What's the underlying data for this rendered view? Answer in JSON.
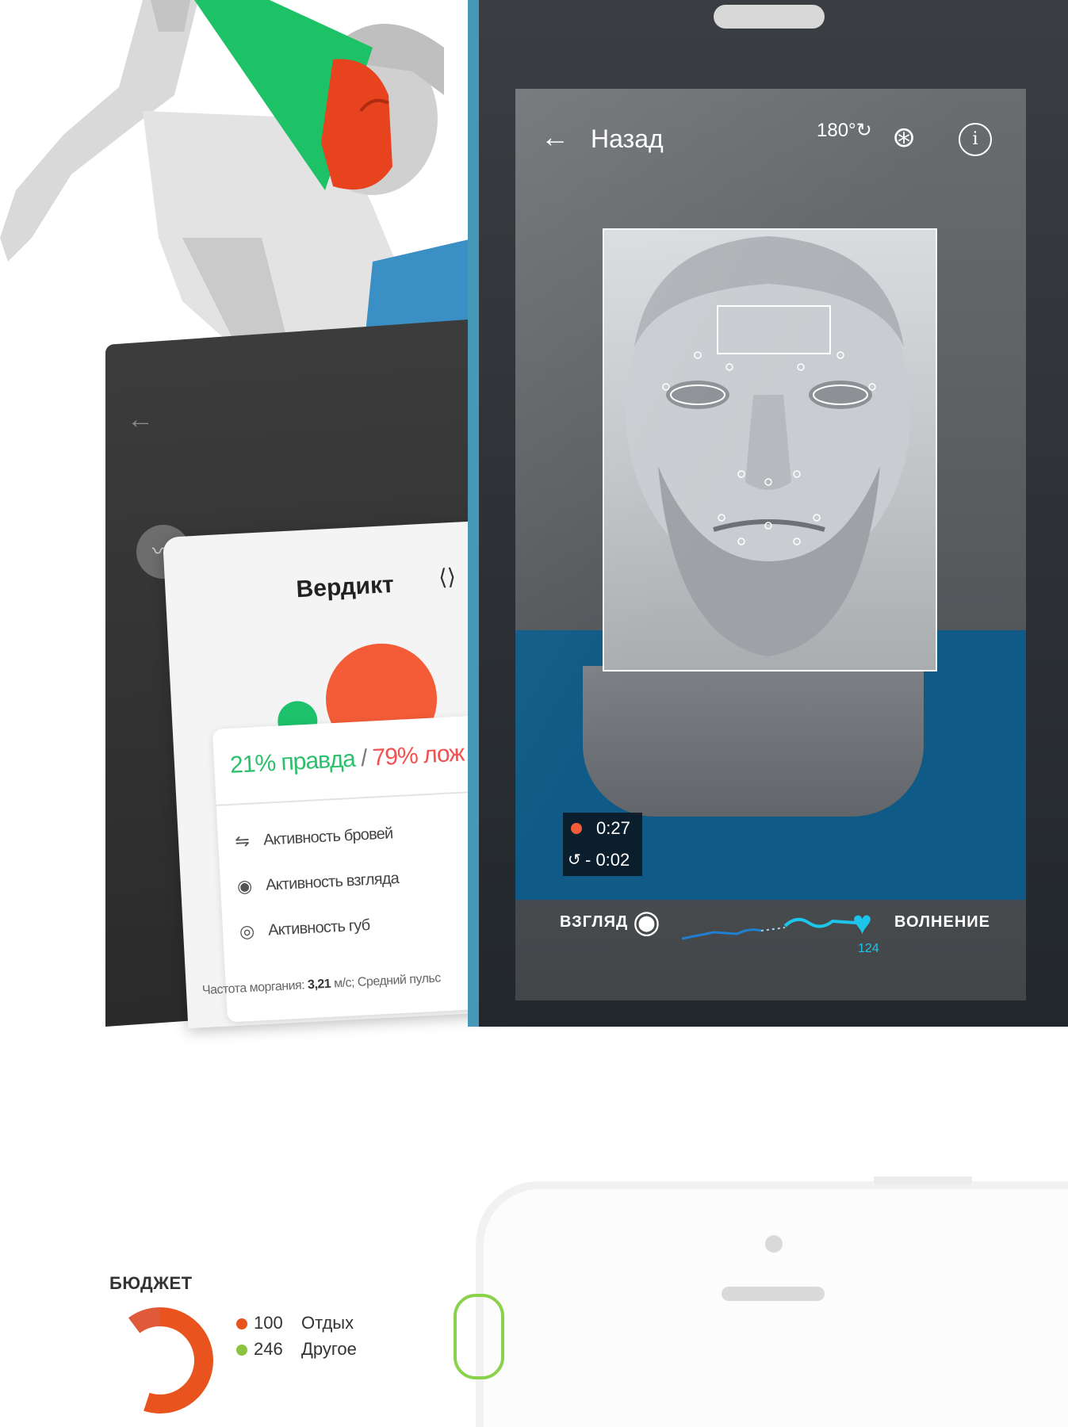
{
  "back_screen": {
    "back_arrow": "←",
    "avatar_icon": "lips-icon"
  },
  "verdict": {
    "title": "Вердикт",
    "share_icon": "share-icon",
    "result_true": "21% правда",
    "result_separator": " / ",
    "result_false": "79% лож",
    "metrics": [
      {
        "icon": "eyebrow-icon",
        "label": "Активность бровей"
      },
      {
        "icon": "eye-icon",
        "label": "Активность взгляда"
      },
      {
        "icon": "lips-icon",
        "label": "Активность губ"
      }
    ],
    "stats_prefix": "Частота моргания: ",
    "stats_blink": "3,21",
    "stats_blink_unit": " м/с; ",
    "stats_pulse": "Средний пульс"
  },
  "camera_screen": {
    "back_label": "Назад",
    "back_arrow": "←",
    "rotate_label": "180°",
    "info_glyph": "i",
    "record_time": "0:27",
    "delay_time": "- 0:02",
    "gaze_label": "ВЗГЛЯД",
    "stress_label": "ВОЛНЕНИЕ",
    "pulse_value": "124"
  },
  "budget": {
    "title": "БЮДЖЕТ",
    "legend": [
      {
        "value": "100",
        "label": "Отдых",
        "color": "#e8531e"
      },
      {
        "value": "246",
        "label": "Другое",
        "color": "#8ac43f"
      }
    ]
  },
  "colors": {
    "true_green": "#2dbf6b",
    "false_red": "#f45050",
    "accent_orange": "#f45c38",
    "pulse_cyan": "#1cc5e9",
    "phone_blue": "#4598b8"
  }
}
